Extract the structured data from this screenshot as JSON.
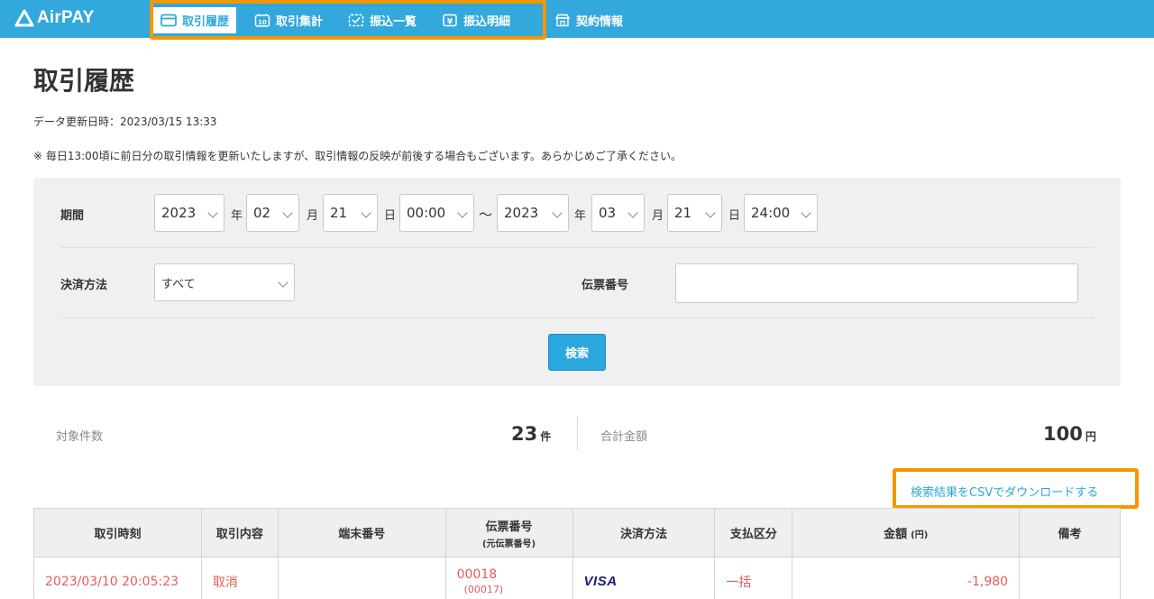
{
  "brand": {
    "name": "AirPAY"
  },
  "nav": {
    "items": [
      {
        "label": "取引履歴",
        "icon": "card-icon",
        "active": true
      },
      {
        "label": "取引集計",
        "icon": "calendar-10-icon",
        "active": false
      },
      {
        "label": "振込一覧",
        "icon": "checklist-icon",
        "active": false
      },
      {
        "label": "振込明細",
        "icon": "yen-receipt-icon",
        "active": false
      },
      {
        "label": "契約情報",
        "icon": "shop-icon",
        "active": false
      }
    ]
  },
  "page": {
    "title": "取引履歴",
    "updated": "データ更新日時：2023/03/15 13:33",
    "notice": "※ 毎日13:00頃に前日分の取引情報を更新いたしますが、取引情報の反映が前後する場合もございます。あらかじめご了承ください。"
  },
  "search": {
    "period_label": "期間",
    "from": {
      "year": "2023",
      "month": "02",
      "day": "21",
      "time": "00:00"
    },
    "to": {
      "year": "2023",
      "month": "03",
      "day": "21",
      "time": "24:00"
    },
    "units": {
      "year": "年",
      "month": "月",
      "day": "日",
      "tilde": "〜"
    },
    "payment_label": "決済方法",
    "payment_value": "すべて",
    "slip_label": "伝票番号",
    "slip_value": "",
    "button": "検索"
  },
  "summary": {
    "count_label": "対象件数",
    "count_value": "23",
    "count_unit": "件",
    "total_label": "合計金額",
    "total_value": "100",
    "total_unit": "円"
  },
  "csv_link": "検索結果をCSVでダウンロードする",
  "table": {
    "headers": {
      "time": "取引時刻",
      "type": "取引内容",
      "terminal": "端末番号",
      "slip": "伝票番号",
      "slip_sub": "(元伝票番号)",
      "method": "決済方法",
      "pay_type": "支払区分",
      "amount": "金額",
      "amount_unit": "(円)",
      "note": "備考"
    },
    "rows": [
      {
        "time": "2023/03/10 20:05:23",
        "type": "取消",
        "terminal": "",
        "slip": "00018",
        "slip_original": "(00017)",
        "method": "VISA",
        "pay_type": "一括",
        "amount": "-1,980",
        "note": ""
      }
    ]
  },
  "colors": {
    "header_bg": "#32a8dd",
    "highlight": "#f39800",
    "accent": "#2ba6de",
    "negative": "#e85a5a"
  }
}
